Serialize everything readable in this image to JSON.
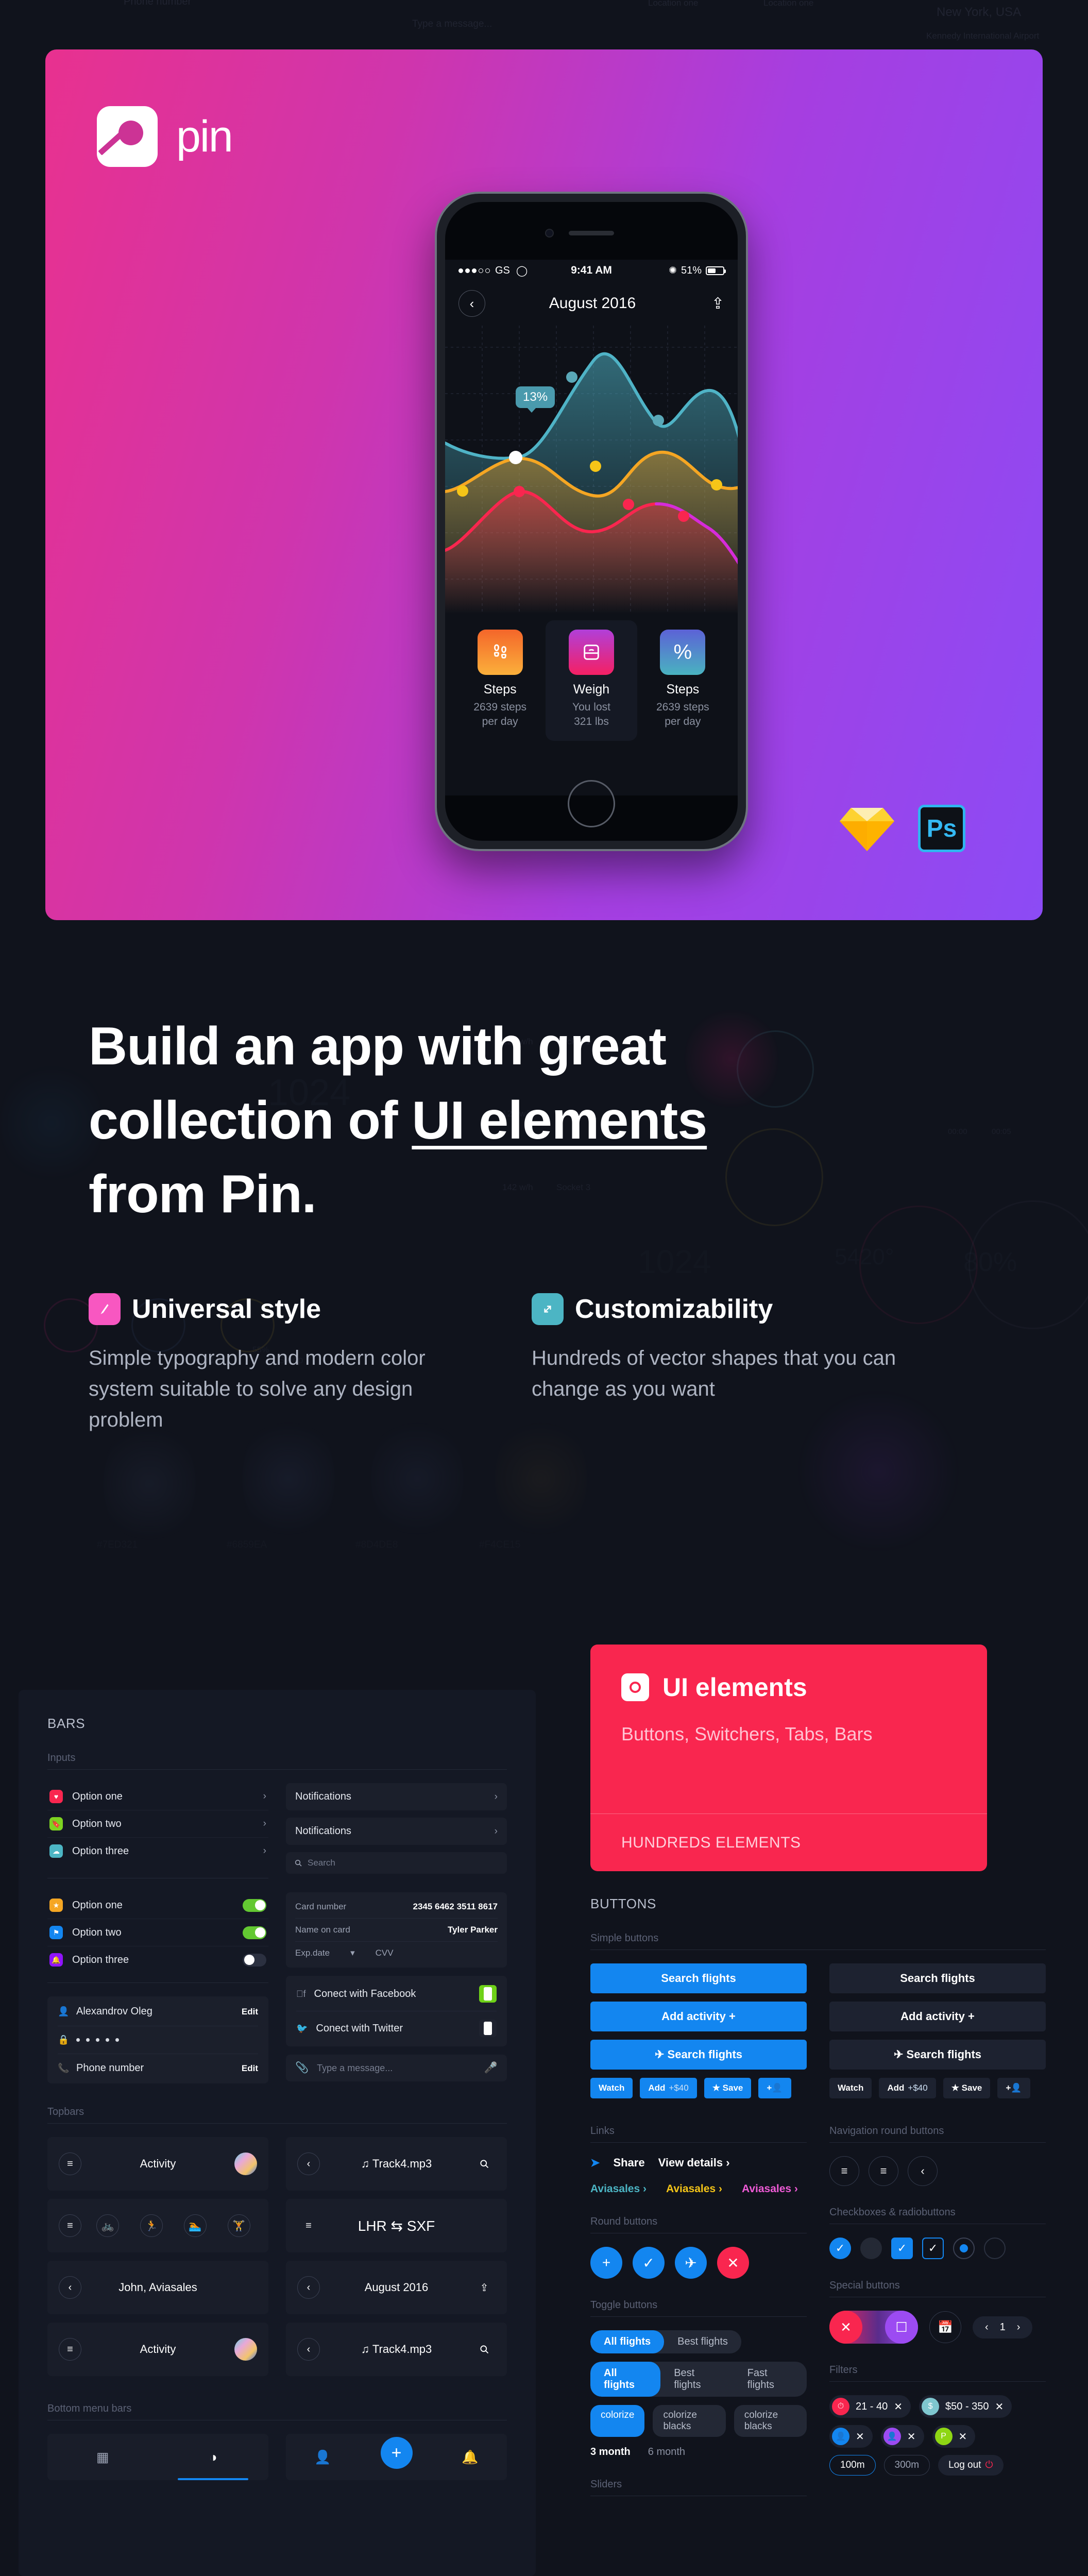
{
  "hero": {
    "logo_text": "pin",
    "logo_icon": "pin-logo-icon",
    "badges": {
      "sketch": "sketch-diamond-icon",
      "photoshop": "Ps"
    },
    "phone": {
      "statusbar": {
        "carrier": "GS",
        "time": "9:41 AM",
        "battery": "51%",
        "wifi_icon": "wifi-icon",
        "bluetooth_icon": "bluetooth-icon"
      },
      "navbar": {
        "back_icon": "‹",
        "title": "August 2016",
        "share_icon": "⤴"
      },
      "chart_tooltip": "13%",
      "stats": [
        {
          "icon": "footsteps-icon",
          "glyph": "ʘ",
          "title": "Steps",
          "line1": "2639 steps",
          "line2": "per day",
          "color": "orange",
          "active": false
        },
        {
          "icon": "scale-icon",
          "glyph": "▢",
          "title": "Weigh",
          "line1": "You lost",
          "line2": "321 lbs",
          "color": "pink",
          "active": true
        },
        {
          "icon": "percent-icon",
          "glyph": "%",
          "title": "Steps",
          "line1": "2639 steps",
          "line2": "per day",
          "color": "blue",
          "active": false
        }
      ]
    }
  },
  "headline": {
    "line1": "Build an app with great",
    "line2_pre": "collection of ",
    "line2_underlined": "UI elements",
    "line3": "from Pin."
  },
  "features": [
    {
      "icon": "pen-icon",
      "glyph": "╱",
      "color": "#f857c1",
      "title": "Universal style",
      "body": "Simple typography and modern color system suitable to solve any design problem"
    },
    {
      "icon": "resize-arrow-icon",
      "glyph": "↗",
      "color": "#4cb5c4",
      "title": "Customizability",
      "body": "Hundreds of vector shapes that you can change as you want"
    }
  ],
  "ui_elements_card": {
    "icon": "target-icon",
    "title": "UI elements",
    "subtitle": "Buttons, Switchers, Tabs, Bars",
    "footer": "HUNDREDS ELEMENTS",
    "accent": "#f9264f"
  },
  "bars_panel": {
    "title": "BARS",
    "sections": {
      "inputs": "Inputs",
      "topbars": "Topbars",
      "bottom_menu_bars": "Bottom menu bars"
    },
    "list_rows": [
      {
        "label": "Option one",
        "icon": "heart-icon",
        "glyph": "♥",
        "color": "#f9264f",
        "trailing": "chevron"
      },
      {
        "label": "Option two",
        "icon": "bookmark-icon",
        "glyph": "⚑",
        "color": "#7ed321",
        "trailing": "chevron"
      },
      {
        "label": "Option three",
        "icon": "cloud-icon",
        "glyph": "☁",
        "color": "#4cb5c4",
        "trailing": "chevron"
      }
    ],
    "toggle_rows": [
      {
        "label": "Option one",
        "icon": "star-icon",
        "glyph": "★",
        "color": "#f5a623",
        "state": "on"
      },
      {
        "label": "Option two",
        "icon": "flag-icon",
        "glyph": "⚑",
        "color": "#1386f0",
        "state": "on"
      },
      {
        "label": "Option three",
        "icon": "bell-icon",
        "glyph": "▲",
        "color": "#9013fe",
        "state": "off"
      }
    ],
    "notification_bars": [
      "Notifications",
      "Notifications"
    ],
    "search_placeholder": "Search",
    "card_form": [
      {
        "key": "Card number",
        "value": "2345 6462 3511 8617"
      },
      {
        "key": "Name on card",
        "value": "Tyler Parker"
      },
      {
        "key": "Exp.date",
        "value": "CVV"
      }
    ],
    "account_rows": [
      {
        "icon": "person-icon",
        "label": "Alexandrov Oleg",
        "action": "Edit"
      },
      {
        "icon": "lock-icon",
        "label": "• • • • •",
        "action": ""
      },
      {
        "icon": "phone-icon",
        "label": "Phone number",
        "action": "Edit"
      }
    ],
    "social_rows": [
      {
        "icon": "facebook-icon",
        "label": "Conect with Facebook",
        "state": "on"
      },
      {
        "icon": "twitter-icon",
        "label": "Conect with Twitter",
        "state": "off"
      }
    ],
    "message_placeholder": "Type a message...",
    "topbars": [
      {
        "left": "menu-icon",
        "title": "Activity",
        "right": "avatar"
      },
      {
        "left": "back-icon",
        "title": "♫ Track4.mp3",
        "right": "search-icon"
      },
      {
        "left": "menu-icon",
        "title": "",
        "right": "",
        "icons": [
          "bike-icon",
          "run-icon",
          "swim-icon",
          "gym-icon"
        ]
      },
      {
        "left": "menu-icon",
        "title": "LHR ⇆ SXF",
        "right": ""
      },
      {
        "left": "back-icon",
        "title": "John, Aviasales",
        "right": ""
      },
      {
        "left": "back-icon",
        "title": "August 2016",
        "right": "share-icon"
      },
      {
        "left": "menu-icon",
        "title": "Activity",
        "right": "avatar"
      },
      {
        "left": "back-icon",
        "title": "♫ Track4.mp3",
        "right": "search-icon"
      }
    ],
    "bottom_menus": [
      {
        "items": [
          "grid-icon",
          "contrast-icon"
        ],
        "active": 1
      },
      {
        "items": [
          "person-icon",
          "plus-fab",
          "bell-icon"
        ],
        "active": -1
      }
    ]
  },
  "buttons_panel": {
    "title": "BUTTONS",
    "labels": {
      "simple_buttons": "Simple buttons",
      "links": "Links",
      "round_buttons": "Round buttons",
      "toggle_buttons": "Toggle buttons",
      "navigation_round_buttons": "Navigation round buttons",
      "checkboxes": "Checkboxes & radiobuttons",
      "special_buttons": "Special buttons",
      "filters": "Filters",
      "sliders": "Sliders"
    },
    "primary_buttons": [
      "Search flights",
      "Add activity +",
      "✈ Search flights"
    ],
    "ghost_buttons": [
      "Search flights",
      "Add activity +",
      "✈ Search flights"
    ],
    "small_buttons": [
      {
        "label": "Watch",
        "extra": ""
      },
      {
        "label": "Add",
        "extra": "+$40"
      },
      {
        "label": "★ Save",
        "extra": ""
      },
      {
        "label": "+●",
        "extra": ""
      }
    ],
    "links": {
      "share": "Share",
      "view_details": "View details",
      "accent_links": [
        {
          "text": "Aviasales",
          "color": "#4cb5c4"
        },
        {
          "text": "Aviasales",
          "color": "#f5c518"
        },
        {
          "text": "Aviasales",
          "color": "#ef5bd6"
        }
      ]
    },
    "round_buttons": [
      {
        "glyph": "+",
        "color": "blue",
        "name": "add-round-button"
      },
      {
        "glyph": "✓",
        "color": "blue",
        "name": "check-round-button"
      },
      {
        "glyph": "✈",
        "color": "blue",
        "name": "plane-round-button"
      },
      {
        "glyph": "✕",
        "color": "pink",
        "name": "close-round-button"
      }
    ],
    "segment_2": [
      "All flights",
      "Best flights"
    ],
    "segment_3": [
      "All flights",
      "Best flights",
      "Fast flights"
    ],
    "chips": [
      "colorize",
      "colorize blacks",
      "colorize blacks"
    ],
    "months": [
      "3 month",
      "6 month"
    ],
    "pager": {
      "prev": "‹",
      "page": "1",
      "next": "›"
    },
    "filter_tags": [
      {
        "label": "21 - 40",
        "color": "#f9264f",
        "glyph": "⏱"
      },
      {
        "label": "$50 - 350",
        "color": "#7fc7cf",
        "glyph": "$"
      },
      {
        "label": "",
        "color": "#1386f0",
        "glyph": "●"
      },
      {
        "label": "",
        "color": "#9c4bf2",
        "glyph": "●"
      },
      {
        "label": "",
        "color": "#8ed614",
        "glyph": "P"
      }
    ],
    "outline_buttons": [
      {
        "label": "100m",
        "state": "selected"
      },
      {
        "label": "300m",
        "state": "unselected"
      }
    ],
    "logout": "Log out"
  },
  "background_labels": [
    "New York, USA",
    "Kennedy International Airport",
    "Type a message...",
    "Location one",
    "Phone number",
    "Edit",
    "1024",
    "5420°",
    "80%",
    "123 w/h",
    "Socket 1",
    "121 w/h",
    "Socket 2",
    "142 w/h",
    "Socket 3",
    "55%",
    "00:00",
    "00:05",
    "Drink",
    "Food",
    "Sleep",
    "#7ED321",
    "#6859EA",
    "#8D4DE8",
    "#F4CE15"
  ]
}
